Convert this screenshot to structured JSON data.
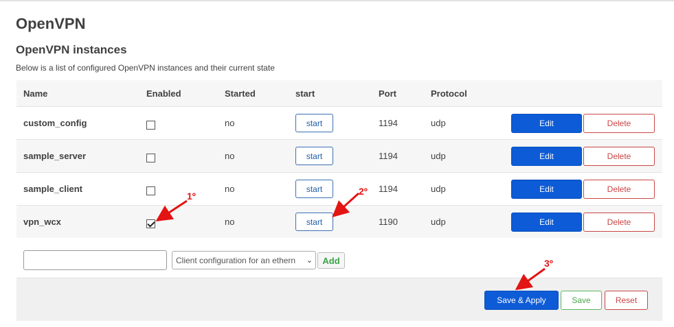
{
  "page": {
    "title": "OpenVPN",
    "section_title": "OpenVPN instances",
    "description": "Below is a list of configured OpenVPN instances and their current state"
  },
  "table": {
    "headers": [
      "Name",
      "Enabled",
      "Started",
      "start",
      "Port",
      "Protocol"
    ],
    "rows": [
      {
        "name": "custom_config",
        "enabled": false,
        "started": "no",
        "start_label": "start",
        "port": "1194",
        "protocol": "udp",
        "edit_label": "Edit",
        "delete_label": "Delete"
      },
      {
        "name": "sample_server",
        "enabled": false,
        "started": "no",
        "start_label": "start",
        "port": "1194",
        "protocol": "udp",
        "edit_label": "Edit",
        "delete_label": "Delete"
      },
      {
        "name": "sample_client",
        "enabled": false,
        "started": "no",
        "start_label": "start",
        "port": "1194",
        "protocol": "udp",
        "edit_label": "Edit",
        "delete_label": "Delete"
      },
      {
        "name": "vpn_wcx",
        "enabled": true,
        "started": "no",
        "start_label": "start",
        "port": "1190",
        "protocol": "udp",
        "edit_label": "Edit",
        "delete_label": "Delete"
      }
    ]
  },
  "add_section": {
    "name_value": "",
    "template_selected": "Client configuration for an ethern",
    "add_label": "Add"
  },
  "footer": {
    "save_apply_label": "Save & Apply",
    "save_label": "Save",
    "reset_label": "Reset"
  },
  "annotations": {
    "step1": "1º",
    "step2": "2º",
    "step3": "3º",
    "color": "#e31414"
  }
}
